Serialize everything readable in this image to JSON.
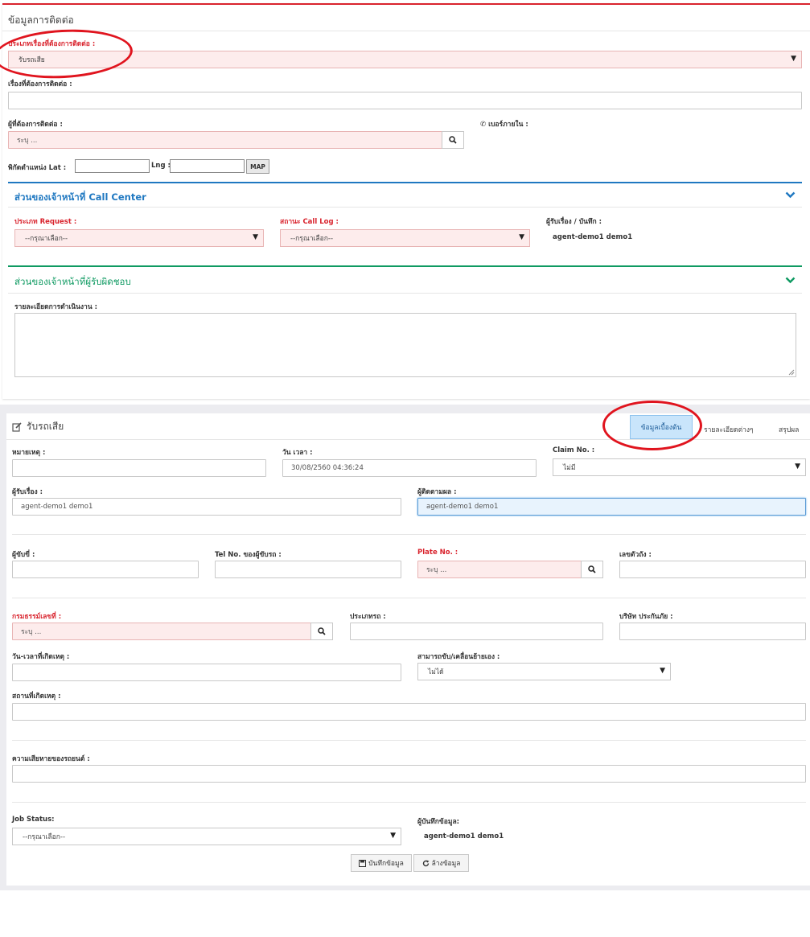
{
  "contact": {
    "title": "ข้อมูลการติดต่อ",
    "topic_type_label": "ประเภทเรื่องที่ต้องการติดต่อ :",
    "topic_type_value": "รับรถเสีย",
    "topic_label": "เรื่องที่ต้องการติดต่อ :",
    "topic_value": "",
    "contact_person_label": "ผู้ที่ต้องการติดต่อ :",
    "contact_person_placeholder": "ระบุ ...",
    "ext_label": "เบอร์ภายใน :",
    "lat_label": "พิกัดตำแหน่ง Lat :",
    "lng_label": "Lng :",
    "map_button": "MAP"
  },
  "call_center": {
    "title": "ส่วนของเจ้าหน้าที่ Call Center",
    "request_type_label": "ประเภท Request :",
    "request_type_value": "--กรุณาเลือก--",
    "call_log_label": "สถานะ Call Log :",
    "call_log_value": "--กรุณาเลือก--",
    "receiver_label": "ผู้รับเรื่อง / บันทึก :",
    "receiver_value": "agent-demo1 demo1"
  },
  "responsible": {
    "title": "ส่วนของเจ้าหน้าที่ผู้รับผิดชอบ",
    "details_label": "รายละเอียดการดำเนินงาน :"
  },
  "breakdown": {
    "title": "รับรถเสีย",
    "tabs": [
      "ข้อมูลเบื้องต้น",
      "รายละเอียดต่างๆ",
      "สรุปผล"
    ],
    "note_label": "หมายเหตุ :",
    "datetime_label": "วัน เวลา :",
    "datetime_value": "30/08/2560 04:36:24",
    "claim_label": "Claim No. :",
    "claim_value": "ไม่มี",
    "receiver_label": "ผู้รับเรื่อง :",
    "receiver_value": "agent-demo1 demo1",
    "follower_label": "ผู้ติดตามผล :",
    "follower_value": "agent-demo1 demo1",
    "driver_label": "ผู้ขับขี่ :",
    "driver_tel_label": "Tel No. ของผู้ขับรถ :",
    "plate_label": "Plate No. :",
    "plate_placeholder": "ระบุ ...",
    "chassis_label": "เลขตัวถัง :",
    "policy_label": "กรมธรรม์เลขที่ :",
    "policy_placeholder": "ระบุ ...",
    "car_type_label": "ประเภทรถ :",
    "insurer_label": "บริษัท ประกันภัย :",
    "incident_time_label": "วัน-เวลาที่เกิดเหตุ :",
    "movable_label": "สามารถขับ/เคลื่อนย้ายเอง :",
    "movable_value": "ไม่ได้",
    "location_label": "สถานที่เกิดเหตุ :",
    "damage_label": "ความเสียหายของรถยนต์ :",
    "job_status_label": "Job Status:",
    "job_status_value": "--กรุณาเลือก--",
    "recorder_label": "ผู้บันทึกข้อมูล:",
    "recorder_value": "agent-demo1 demo1",
    "save_button": "บันทึกข้อมูล",
    "clear_button": "ล้างข้อมูล"
  },
  "colors": {
    "accent_red": "#d9232d",
    "call_center_blue": "#1f78c1",
    "responsible_green": "#0f9a62",
    "annotation_red": "#e0141e"
  }
}
